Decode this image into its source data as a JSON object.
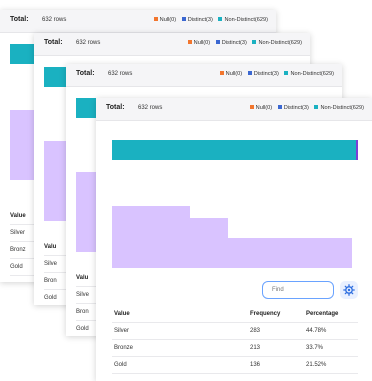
{
  "summary": {
    "total_label": "Total:",
    "rows": "632 rows",
    "legend": [
      {
        "label": "Null(0)",
        "color": "#f2762e"
      },
      {
        "label": "Distinct(3)",
        "color": "#3b67d1"
      },
      {
        "label": "Non-Distinct(629)",
        "color": "#1ab1c1"
      }
    ]
  },
  "colors": {
    "accent_bar": "#1ab1c1",
    "histogram": "#d9c3ff",
    "focus_border": "#6aa3ff"
  },
  "search": {
    "placeholder": "Find"
  },
  "table": {
    "columns": [
      "Value",
      "Frequency",
      "Percentage"
    ],
    "rows": [
      {
        "value": "Silver",
        "frequency": "283",
        "percentage": "44.78%"
      },
      {
        "value": "Bronze",
        "frequency": "213",
        "percentage": "33.7%"
      },
      {
        "value": "Gold",
        "frequency": "136",
        "percentage": "21.52%"
      }
    ]
  },
  "back_panel_fragments": {
    "value_header": "Valu",
    "value_header_full": "Value",
    "rows": [
      "Silver",
      "Bron",
      "Gold",
      "Silve",
      "Bronz",
      "Silve"
    ]
  }
}
